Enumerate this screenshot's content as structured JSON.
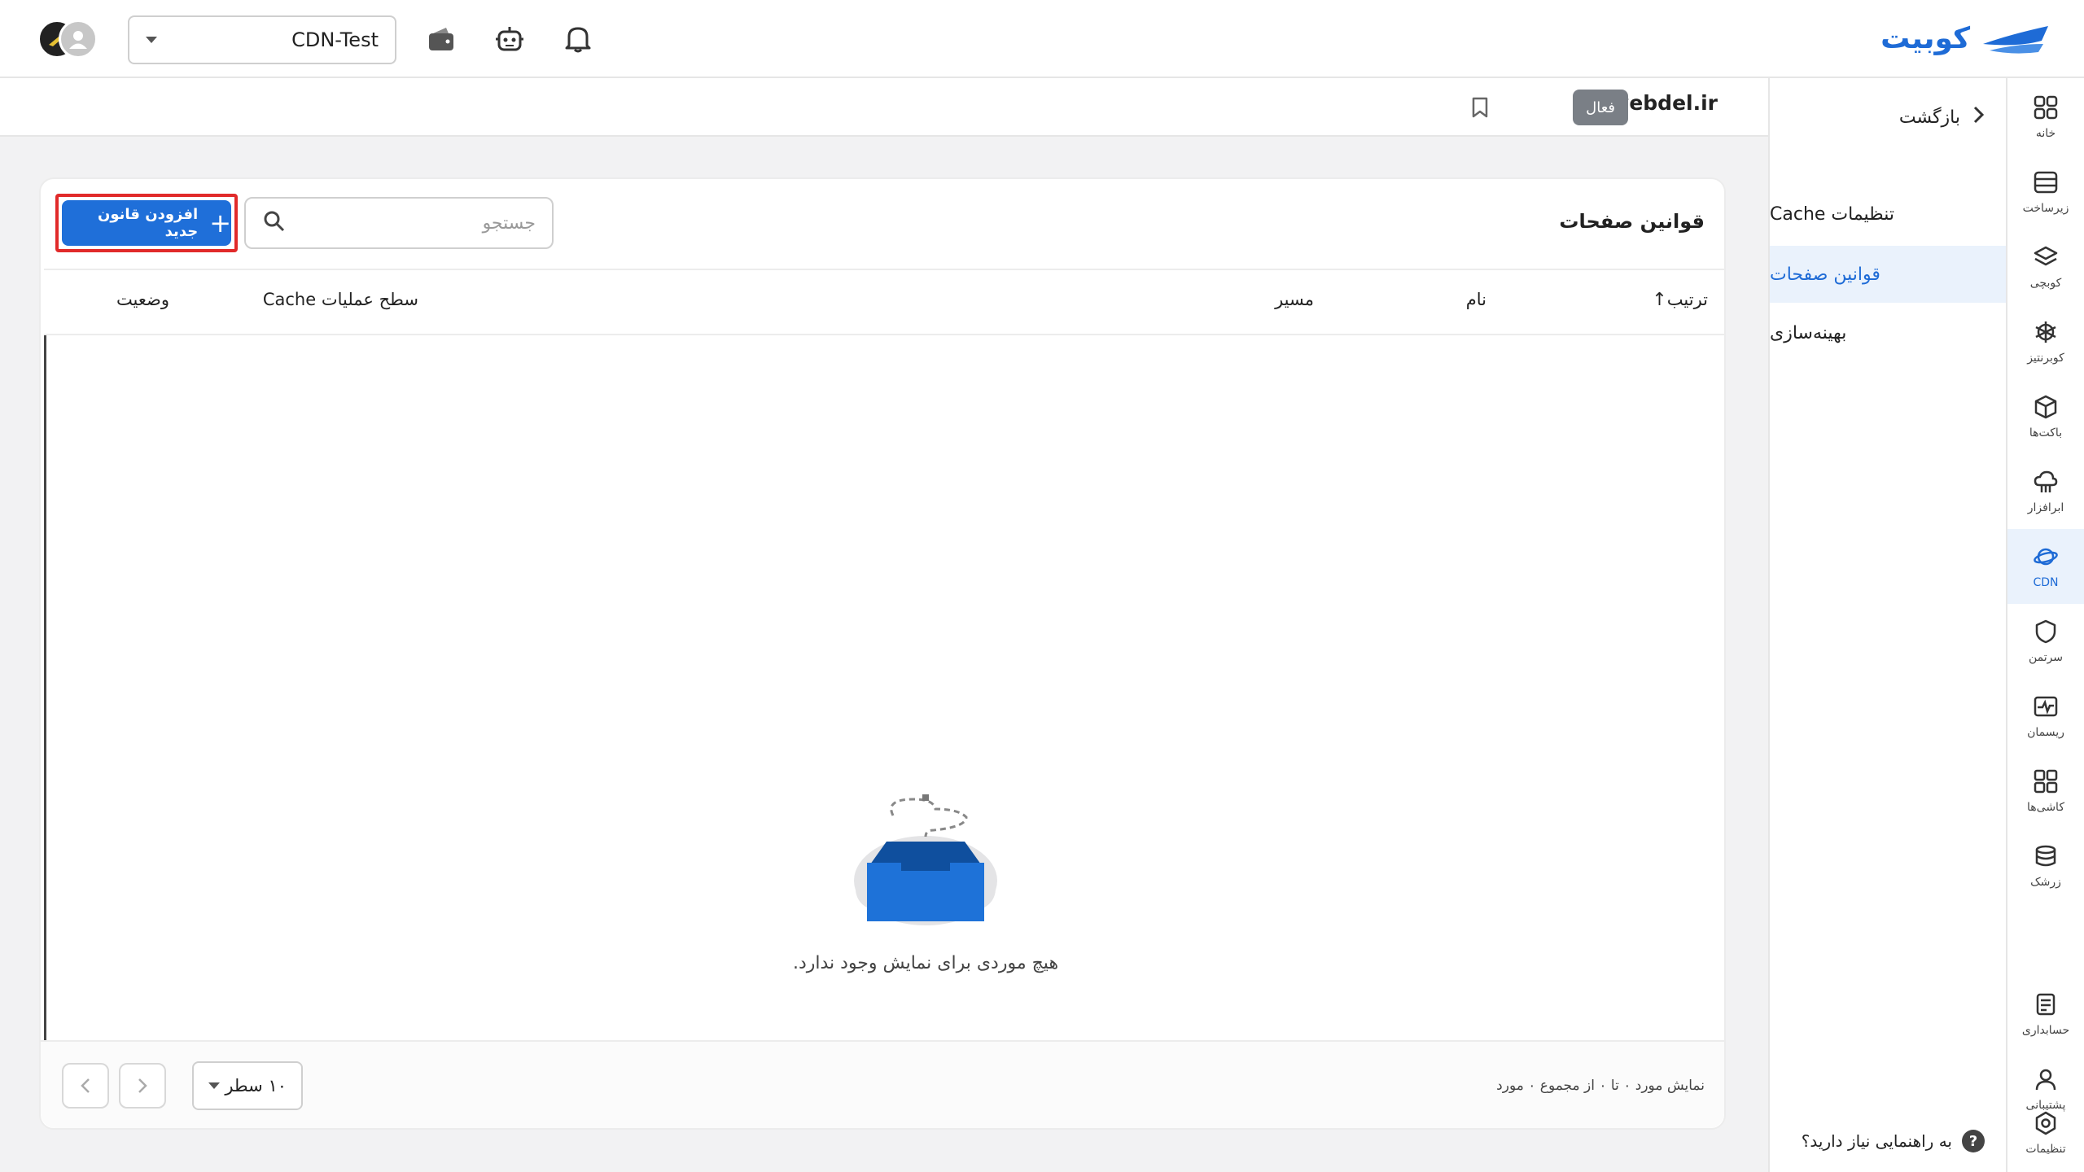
{
  "brand": {
    "name": "کوبیت",
    "color": "#1e6bd6"
  },
  "header": {
    "project_select": {
      "value": "CDN-Test"
    },
    "icons": [
      "bell-icon",
      "robot-icon",
      "wallet-icon"
    ]
  },
  "rail": {
    "items": [
      {
        "label": "خانه",
        "icon": "home-grid-icon"
      },
      {
        "label": "زیرساخت",
        "icon": "server-icon"
      },
      {
        "label": "کوبچی",
        "icon": "layers-icon"
      },
      {
        "label": "کوبرنتیز",
        "icon": "helm-icon"
      },
      {
        "label": "باکت‌ها",
        "icon": "box-icon"
      },
      {
        "label": "ابرافزار",
        "icon": "cloud-app-icon"
      },
      {
        "label": "CDN",
        "icon": "cdn-icon",
        "active": true
      },
      {
        "label": "سرتمن",
        "icon": "shield-icon"
      },
      {
        "label": "ریسمان",
        "icon": "pulse-icon"
      },
      {
        "label": "کاشی‌ها",
        "icon": "tiles-icon"
      },
      {
        "label": "زرشک",
        "icon": "database-icon"
      },
      {
        "label": "حسابداری",
        "icon": "accounting-icon"
      },
      {
        "label": "پشتیبانی",
        "icon": "support-icon"
      },
      {
        "label": "تنظیمات",
        "icon": "settings-icon"
      }
    ]
  },
  "sidebar": {
    "back": "بازگشت",
    "links": [
      {
        "label": "تنظیمات Cache"
      },
      {
        "label": "قوانین صفحات",
        "active": true
      },
      {
        "label": "بهینه‌سازی"
      }
    ],
    "help": {
      "icon_text": "?",
      "label": "به راهنمایی نیاز دارید؟"
    }
  },
  "domain": {
    "name": "webdel.ir",
    "status": "فعال"
  },
  "main": {
    "title": "قوانین صفحات",
    "search_placeholder": "جستجو",
    "add_button": "افزودن قانون جدید",
    "columns": {
      "order": "ترتیب",
      "name": "نام",
      "path": "مسیر",
      "cache_level": "سطح عملیات Cache",
      "status": "وضعیت"
    },
    "empty_message": "هیچ موردی برای نمایش وجود ندارد.",
    "footer": {
      "page_info": "نمایش مورد ۰ تا ۰ از مجموع ۰ مورد",
      "rows_per_page": "۱۰ سطر"
    }
  }
}
